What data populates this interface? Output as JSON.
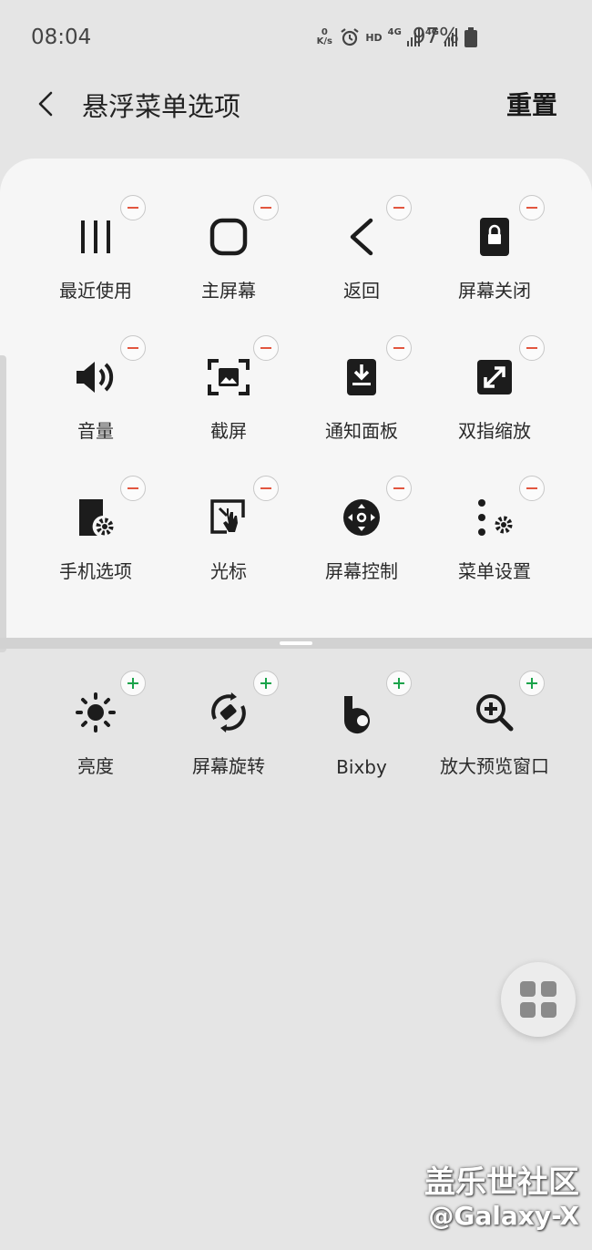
{
  "status_bar": {
    "time": "08:04",
    "speed_value": "0",
    "speed_unit": "K/s",
    "hd": "HD",
    "net1": "4G",
    "net2": "4G",
    "battery": "97%"
  },
  "header": {
    "title": "悬浮菜单选项",
    "reset_label": "重置"
  },
  "active_items": [
    {
      "label": "最近使用",
      "icon": "recents-icon"
    },
    {
      "label": "主屏幕",
      "icon": "home-icon"
    },
    {
      "label": "返回",
      "icon": "back-icon"
    },
    {
      "label": "屏幕关闭",
      "icon": "screen-lock-icon"
    },
    {
      "label": "音量",
      "icon": "volume-icon"
    },
    {
      "label": "截屏",
      "icon": "screenshot-icon"
    },
    {
      "label": "通知面板",
      "icon": "notification-panel-icon"
    },
    {
      "label": "双指缩放",
      "icon": "pinch-zoom-icon"
    },
    {
      "label": "手机选项",
      "icon": "phone-options-icon"
    },
    {
      "label": "光标",
      "icon": "cursor-icon"
    },
    {
      "label": "屏幕控制",
      "icon": "screen-control-icon"
    },
    {
      "label": "菜单设置",
      "icon": "menu-settings-icon"
    }
  ],
  "available_items": [
    {
      "label": "亮度",
      "icon": "brightness-icon"
    },
    {
      "label": "屏幕旋转",
      "icon": "rotate-icon"
    },
    {
      "label": "Bixby",
      "icon": "bixby-icon"
    },
    {
      "label": "放大预览窗口",
      "icon": "magnifier-icon"
    }
  ],
  "colors": {
    "remove_badge": "#e2563f",
    "add_badge": "#1aa34a",
    "panel_bg": "#f6f6f6",
    "page_bg": "#e5e5e5"
  },
  "watermark": {
    "line1": "盖乐世社区",
    "line2": "@Galaxy-X"
  }
}
